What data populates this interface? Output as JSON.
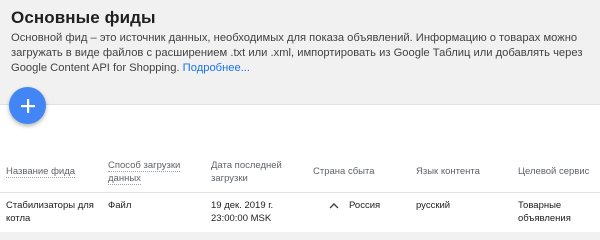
{
  "header": {
    "title": "Основные фиды",
    "description": "Основной фид – это источник данных, необходимых для показа объявлений. Информацию о товарах можно загружать в виде файлов с расширением .txt или .xml, импортировать из Google Таблиц или добавлять через Google Content API for Shopping.",
    "more_link": "Подробнее..."
  },
  "fab": {
    "icon": "plus-icon",
    "color": "#4285f4"
  },
  "table": {
    "columns": {
      "name": "Название фида",
      "method": "Способ загрузки данных",
      "last_upload": "Дата последней загрузки",
      "country": "Страна сбыта",
      "language": "Язык контента",
      "service": "Целевой сервис"
    },
    "rows": [
      {
        "name": "Стабилизаторы для котла",
        "method": "Файл",
        "last_upload": "19 дек. 2019 г. 23:00:00 MSK",
        "country": "Россия",
        "language": "русский",
        "service": "Товарные объявления"
      }
    ]
  },
  "colors": {
    "link": "#1a73e8",
    "background": "#f1f1f1",
    "card": "#ffffff"
  }
}
